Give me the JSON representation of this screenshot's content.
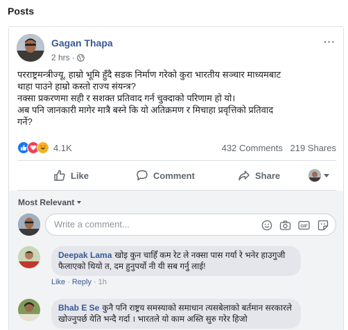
{
  "section": {
    "title": "Posts"
  },
  "post": {
    "author": "Gagan Thapa",
    "time": "2 hrs",
    "more_label": "···",
    "text_lines": [
      "परराष्ट्रमन्त्रीज्यू, हाम्रो भूमि हुँदै सडक निर्माण गरेको कुरा भारतीय सञ्चार माध्यमबाट",
      "थाहा पाउने हाम्रो कस्तो राज्य संयन्त्र?",
      "नक्सा प्रकरणमा सही र सशक्त प्रतिवाद गर्न चुक्दाको परिणाम हो यो।",
      "अब पनि जानकारी मागेर मात्रै बस्ने कि यो अतिक्रमण र मिचाहा प्रवृत्तिको प्रतिवाद",
      "गर्ने?"
    ],
    "reactions": [
      "like",
      "love",
      "haha"
    ],
    "reaction_count": "4.1K",
    "comments_count": "432 Comments",
    "shares_count": "219 Shares"
  },
  "actions": {
    "like": "Like",
    "comment": "Comment",
    "share": "Share"
  },
  "comments": {
    "sort_label": "Most Relevant",
    "input_placeholder": "Write a comment...",
    "items": [
      {
        "name": "Deepak Lama",
        "text": "खोइ कुन चाहिँ कम रेट ले नक्सा पास गर्या रे भनेर हाउगुजी फैलाएको थियो त, दम हुनुपर्यो नी यी सब गर्नु लाई!",
        "like": "Like",
        "reply": "Reply",
        "time": "1h"
      },
      {
        "name": "Bhab E Se",
        "text": "कुनै पनि राष्ट्रय समस्याको समाधान त्यसबेलाको बर्तमान सरकारले खोज्नुपर्छ येति भन्दै गर्दा । भारतले यो काम अस्ति सुरु गरेर हिजो"
      }
    ]
  },
  "colors": {
    "link_blue": "#385898",
    "like_blue": "#1877f2",
    "love_red": "#f33e58",
    "haha_yellow": "#f7b125",
    "muted": "#606770"
  },
  "icons": {
    "globe": "globe-icon",
    "like": "thumbs-up-icon",
    "comment": "speech-bubble-icon",
    "share": "share-arrow-icon",
    "emoji": "smiley-icon",
    "camera": "camera-icon",
    "gif": "gif-icon",
    "sticker": "sticker-icon"
  }
}
